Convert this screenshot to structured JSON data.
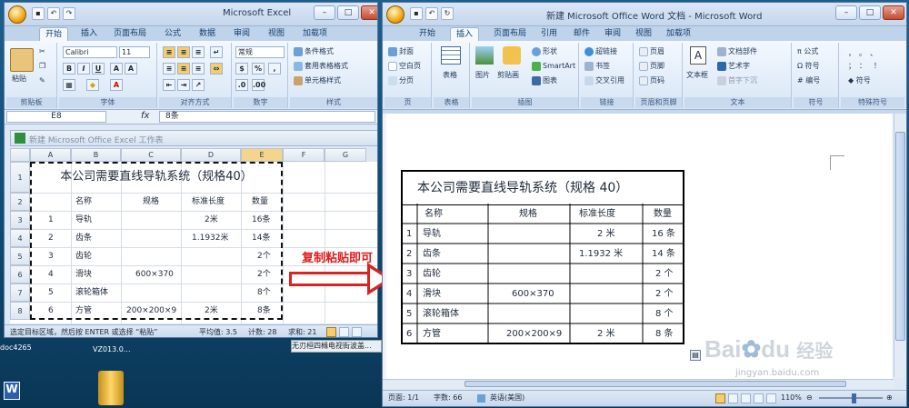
{
  "excel": {
    "title": "Microsoft Excel",
    "tabs": [
      "开始",
      "插入",
      "页面布局",
      "公式",
      "数据",
      "审阅",
      "视图",
      "加载项"
    ],
    "clipboard": {
      "paste": "粘贴",
      "group": "剪贴板"
    },
    "font": {
      "name": "Calibri",
      "size": "11",
      "group": "字体"
    },
    "alignment": {
      "group": "对齐方式"
    },
    "number": {
      "format": "常规",
      "group": "数字",
      "percent": "%"
    },
    "styles": {
      "cond": "条件格式",
      "table": "套用表格格式",
      "cell": "单元格样式",
      "group": "样式"
    },
    "cell_ref": "E8",
    "formula": "8条",
    "workbook_title": "新建 Microsoft Office Excel 工作表",
    "columns": [
      "A",
      "B",
      "C",
      "D",
      "E",
      "F",
      "G"
    ],
    "rows": [
      "1",
      "2",
      "3",
      "4",
      "5",
      "6",
      "7",
      "8",
      "9",
      "10"
    ],
    "status": {
      "hint": "选定目标区域，然后按 ENTER 或选择 “粘贴”",
      "avg": "平均值: 3.5",
      "count": "计数: 28",
      "sum": "求和: 21",
      "zoom": "100%"
    }
  },
  "table": {
    "title": "本公司需要直线导轨系统（规格40）",
    "word_title": "本公司需要直线导轨系统（规格 40）",
    "headers": [
      "名称",
      "规格",
      "标准长度",
      "数量"
    ],
    "rows": [
      {
        "no": "1",
        "name": "导轨",
        "spec": "",
        "length": "2米",
        "qty": "16条"
      },
      {
        "no": "2",
        "name": "齿条",
        "spec": "",
        "length": "1.1932米",
        "qty": "14条"
      },
      {
        "no": "3",
        "name": "齿轮",
        "spec": "",
        "length": "",
        "qty": "2个"
      },
      {
        "no": "4",
        "name": "滑块",
        "spec": "600×370",
        "length": "",
        "qty": "2个"
      },
      {
        "no": "5",
        "name": "滚轮箱体",
        "spec": "",
        "length": "",
        "qty": "8个"
      },
      {
        "no": "6",
        "name": "方管",
        "spec": "200×200×9",
        "length": "2米",
        "qty": "8条"
      }
    ],
    "word_rows": [
      {
        "length": "2 米",
        "qty": "16 条"
      },
      {
        "length": "1.1932 米",
        "qty": "14 条"
      },
      {
        "length": "",
        "qty": "2 个"
      },
      {
        "length": "",
        "qty": "2 个"
      },
      {
        "length": "",
        "qty": "8 个"
      },
      {
        "length": "2 米",
        "qty": "8 条"
      }
    ]
  },
  "arrow_label": "复制粘贴即可",
  "word": {
    "title": "新建 Microsoft Office Word 文档 - Microsoft Word",
    "tabs": [
      "开始",
      "插入",
      "页面布局",
      "引用",
      "邮件",
      "审阅",
      "视图",
      "加载项"
    ],
    "groups": [
      "页",
      "表格",
      "插图",
      "链接",
      "页眉和页脚",
      "文本",
      "符号",
      "特殊符号"
    ],
    "page_items": [
      "封面",
      "空白页",
      "分页"
    ],
    "table_btn": "表格",
    "illus": [
      "图片",
      "剪贴画",
      "形状",
      "SmartArt",
      "图表"
    ],
    "links": [
      "超链接",
      "书签",
      "交叉引用"
    ],
    "hf": [
      "页眉",
      "页脚",
      "页码"
    ],
    "text": [
      "文本框",
      "文档部件",
      "艺术字",
      "首字下沉"
    ],
    "symbols": [
      "公式",
      "符号",
      "编号"
    ],
    "special": [
      "符号"
    ],
    "status": {
      "page": "页面: 1/1",
      "words": "字数: 66",
      "lang": "英语(美国)",
      "zoom": "110%"
    }
  },
  "taskbar": {
    "item1": "doc4265",
    "item2": "VZ013.0...",
    "item3": "无刃桓四橼电视街波盖..."
  },
  "watermark": {
    "brand": "Bai",
    "brand2": "du",
    "cn": "经验",
    "url": "jingyan.baidu.com"
  }
}
